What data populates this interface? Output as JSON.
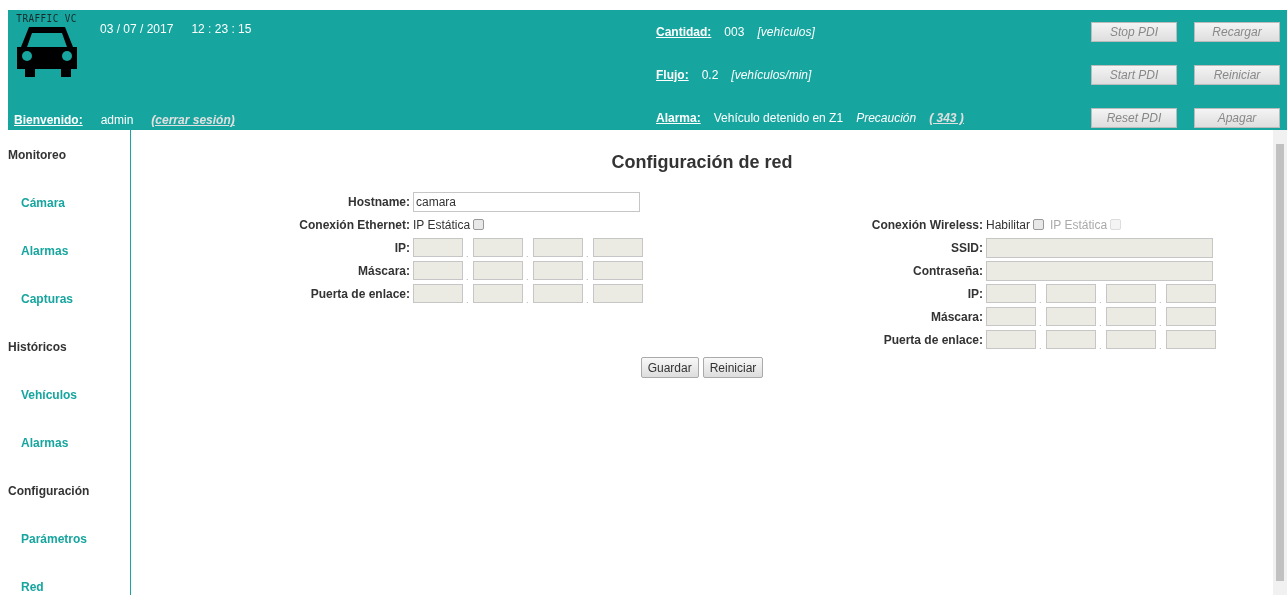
{
  "header": {
    "logo_text": "TRAFFIC VC",
    "date": "03 / 07 / 2017",
    "time": "12 : 23 : 15",
    "welcome_label": "Bienvenido:",
    "user": "admin",
    "logout_link": "(cerrar sesión)",
    "stats": [
      {
        "label": "Cantidad:",
        "items": [
          {
            "kind": "plain",
            "text": "003"
          },
          {
            "kind": "italic",
            "text": "[vehículos]"
          }
        ],
        "buttons": [
          "Stop PDI",
          "Recargar"
        ]
      },
      {
        "label": "Flujo:",
        "items": [
          {
            "kind": "plain",
            "text": "0.2"
          },
          {
            "kind": "italic",
            "text": "[vehículos/min]"
          }
        ],
        "buttons": [
          "Start PDI",
          "Reiniciar"
        ]
      },
      {
        "label": "Alarma:",
        "items": [
          {
            "kind": "plain",
            "text": "Vehículo detenido en Z1"
          },
          {
            "kind": "italic",
            "text": "Precaución"
          },
          {
            "kind": "link",
            "text": "( 343 )"
          }
        ],
        "buttons": [
          "Reset PDI",
          "Apagar"
        ]
      }
    ]
  },
  "sidebar": {
    "items": [
      {
        "kind": "section",
        "label": "Monitoreo"
      },
      {
        "kind": "link",
        "label": "Cámara"
      },
      {
        "kind": "link",
        "label": "Alarmas"
      },
      {
        "kind": "link",
        "label": "Capturas"
      },
      {
        "kind": "section",
        "label": "Históricos"
      },
      {
        "kind": "link",
        "label": "Vehículos"
      },
      {
        "kind": "link",
        "label": "Alarmas"
      },
      {
        "kind": "section",
        "label": "Configuración"
      },
      {
        "kind": "link",
        "label": "Parámetros"
      },
      {
        "kind": "link",
        "label": "Red"
      }
    ]
  },
  "form": {
    "title": "Configuración de red",
    "ethernet": [
      {
        "kind": "text",
        "label": "Hostname:",
        "value": "camara",
        "disabled": false
      },
      {
        "kind": "options",
        "label": "Conexión Ethernet:",
        "options": [
          {
            "label": "IP Estática",
            "checked": false,
            "disabled": false
          }
        ]
      },
      {
        "kind": "ip",
        "label": "IP:",
        "separator": ".",
        "disabled": true
      },
      {
        "kind": "ip",
        "label": "Máscara:",
        "separator": ".",
        "disabled": true
      },
      {
        "kind": "ip",
        "label": "Puerta de enlace:",
        "separator": ".",
        "disabled": true
      }
    ],
    "wireless": [
      {
        "kind": "options",
        "label": "Conexión Wireless:",
        "options": [
          {
            "label": "Habilitar",
            "checked": false,
            "disabled": false
          },
          {
            "label": "IP Estática",
            "checked": false,
            "disabled": true
          }
        ]
      },
      {
        "kind": "text",
        "label": "SSID:",
        "disabled": true
      },
      {
        "kind": "text",
        "label": "Contraseña:",
        "disabled": true
      },
      {
        "kind": "ip",
        "label": "IP:",
        "separator": ".",
        "disabled": true
      },
      {
        "kind": "ip",
        "label": "Máscara:",
        "separator": ".",
        "disabled": true
      },
      {
        "kind": "ip",
        "label": "Puerta de enlace:",
        "separator": ".",
        "disabled": true
      }
    ],
    "buttons": [
      "Guardar",
      "Reiniciar"
    ]
  }
}
